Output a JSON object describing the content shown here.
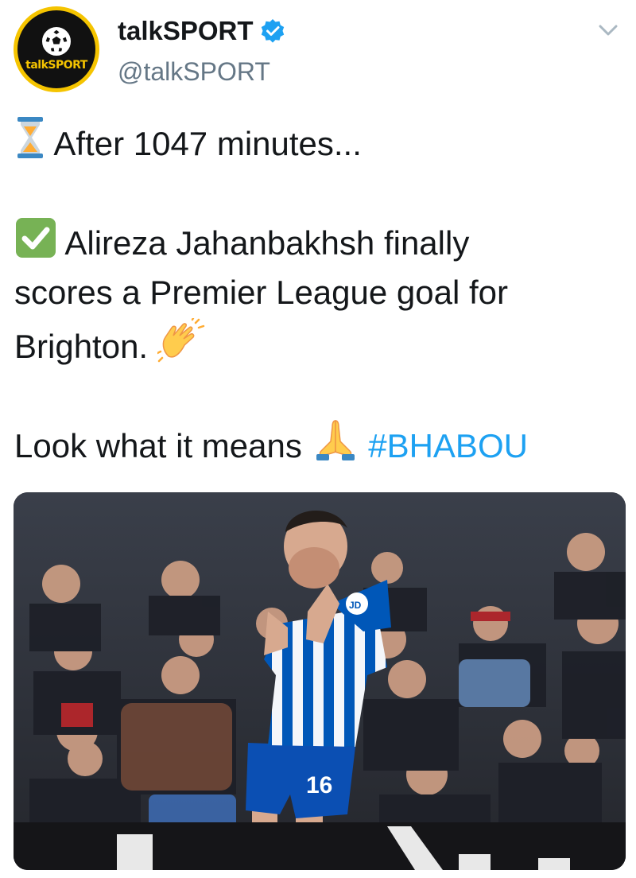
{
  "user": {
    "name": "talkSPORT",
    "handle": "@talkSPORT",
    "avatar_text": "talkSPORT",
    "verified": true
  },
  "tweet": {
    "line1": "After 1047 minutes...",
    "line2": "Alireza Jahanbakhsh finally",
    "line3": "scores a Premier League goal for",
    "line4": "Brighton.",
    "line5": "Look what it means",
    "hashtag": "#BHABOU",
    "emoji_line1": "hourglass-icon",
    "emoji_line2": "check-mark-icon",
    "emoji_line4": "clapping-hands-icon",
    "emoji_line5": "praying-hands-icon"
  },
  "media": {
    "jersey_number": "16",
    "sleeve_badge": "JD"
  },
  "colors": {
    "link": "#1da1f2",
    "secondary_text": "#657786",
    "brand_yellow": "#f5c400",
    "brighton_blue": "#0057b8"
  }
}
